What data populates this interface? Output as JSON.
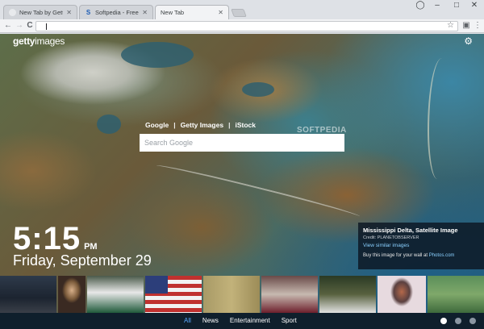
{
  "tabs": [
    {
      "title": "New Tab by Getty Images",
      "favicon": "getty-favicon"
    },
    {
      "title": "Softpedia - Free Downloads",
      "favicon": "softpedia-favicon"
    },
    {
      "title": "New Tab",
      "favicon": ""
    }
  ],
  "window": {
    "profile_icon": "person-icon",
    "minimize": "–",
    "maximize": "□",
    "close": "✕"
  },
  "toolbar": {
    "back": "←",
    "forward": "→",
    "reload": "C",
    "address_value": "",
    "star": "☆",
    "ext": "▣",
    "menu": "⋮"
  },
  "brand": {
    "logo_bold": "getty",
    "logo_regular": "images"
  },
  "search_links": [
    {
      "label": "Google"
    },
    {
      "label": "Getty Images"
    },
    {
      "label": "iStock"
    }
  ],
  "search": {
    "placeholder": "Search Google"
  },
  "watermark": "SOFTPEDIA",
  "clock": {
    "time": "5:15",
    "ampm": "PM",
    "date": "Friday, September 29"
  },
  "image_info": {
    "title": "Mississippi Delta, Satellite Image",
    "credit": "Credit: PLANETOBSERVER",
    "view_similar": "View similar images",
    "buy_prefix": "Buy this image for your wall at",
    "buy_link": "Photos.com"
  },
  "categories": [
    {
      "label": "All",
      "active": true
    },
    {
      "label": "News",
      "active": false
    },
    {
      "label": "Entertainment",
      "active": false
    },
    {
      "label": "Sport",
      "active": false
    }
  ],
  "pager": {
    "count": 3,
    "active": 0
  },
  "colors": {
    "accent": "#5aa8ff",
    "footer": "#0f1f2c"
  }
}
